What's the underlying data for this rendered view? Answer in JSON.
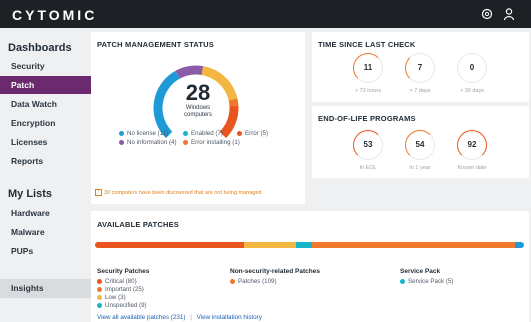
{
  "app": {
    "logo": "CYTOMIC"
  },
  "sidebar": {
    "dashboards_heading": "Dashboards",
    "items": [
      {
        "label": "Security"
      },
      {
        "label": "Patch"
      },
      {
        "label": "Data Watch"
      },
      {
        "label": "Encryption"
      },
      {
        "label": "Licenses"
      },
      {
        "label": "Reports"
      }
    ],
    "lists_heading": "My Lists",
    "list_items": [
      {
        "label": "Hardware"
      },
      {
        "label": "Malware"
      },
      {
        "label": "PUPs"
      }
    ],
    "insights": "Insights"
  },
  "patch_status": {
    "title": "PATCH MANAGEMENT STATUS",
    "total": "28",
    "total_label_1": "Windows",
    "total_label_2": "computers",
    "legend": [
      {
        "text": "No license (11)",
        "color": "#1e9ad6"
      },
      {
        "text": "Enabled (7)",
        "color": "#f2b641"
      },
      {
        "text": "Error (5)",
        "color": "#e8551f"
      },
      {
        "text": "No information (4)",
        "color": "#8b5aa8"
      },
      {
        "text": "Error installing (1)",
        "color": "#f0772c"
      }
    ],
    "gauge_segments": [
      {
        "name": "No license",
        "value": 11,
        "color": "#1e9ad6"
      },
      {
        "name": "No information",
        "value": 4,
        "color": "#8b5aa8"
      },
      {
        "name": "Enabled",
        "value": 7,
        "color": "#f2b641"
      },
      {
        "name": "Error installing",
        "value": 1,
        "color": "#f0772c"
      },
      {
        "name": "Error",
        "value": 5,
        "color": "#e8551f"
      }
    ],
    "warning": "30 computers have been discovered that are not being managed"
  },
  "time_since": {
    "title": "TIME SINCE LAST CHECK",
    "items": [
      {
        "value": "11",
        "label": "> 72 hours"
      },
      {
        "value": "7",
        "label": "> 7 days"
      },
      {
        "value": "0",
        "label": "> 30 days"
      }
    ]
  },
  "eol": {
    "title": "END-OF-LIFE PROGRAMS",
    "items": [
      {
        "value": "53",
        "label": "In EOL"
      },
      {
        "value": "54",
        "label": "In 1 year"
      },
      {
        "value": "92",
        "label": "Known date"
      }
    ]
  },
  "available": {
    "title": "AVAILABLE PATCHES",
    "bar": [
      {
        "value": 80,
        "color": "#e8551f"
      },
      {
        "value": 25,
        "color": "#f2b641"
      },
      {
        "value": 3,
        "color": "#f2b641"
      },
      {
        "value": 9,
        "color": "#17b3c9"
      },
      {
        "value": 109,
        "color": "#f0772c"
      },
      {
        "value": 5,
        "color": "#1e9ad6"
      }
    ],
    "security_heading": "Security Patches",
    "security_items": [
      {
        "text": "Critical (80)",
        "color": "#e8551f"
      },
      {
        "text": "Important (25)",
        "color": "#f0772c"
      },
      {
        "text": "Low (3)",
        "color": "#f2b641"
      },
      {
        "text": "Unspecified (9)",
        "color": "#17b3c9"
      }
    ],
    "nonsec_heading": "Non-security-related Patches",
    "nonsec_items": [
      {
        "text": "Patches (109)",
        "color": "#f0772c"
      }
    ],
    "sp_heading": "Service Pack",
    "sp_items": [
      {
        "text": "Service Pack (5)",
        "color": "#17b3c9"
      }
    ],
    "link_all": "View all available patches (231)",
    "separator": "|",
    "link_history": "View installation history"
  },
  "icons": {
    "settings": "gear-icon",
    "user": "user-icon"
  }
}
